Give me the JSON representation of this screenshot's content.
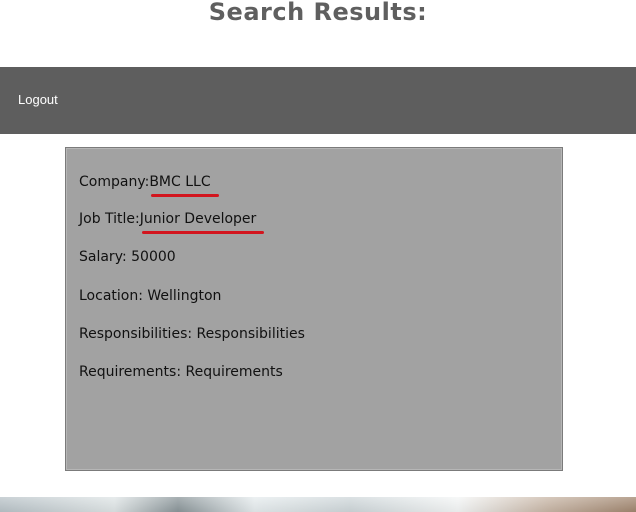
{
  "page": {
    "title": "Search Results:"
  },
  "navbar": {
    "logout_label": "Logout",
    "background": "#5e5e5e"
  },
  "result": {
    "company": {
      "label": "Company:",
      "value": "BMC LLC"
    },
    "job_title": {
      "label": "Job Title:",
      "value": "Junior Developer"
    },
    "salary": {
      "label": "Salary: ",
      "value": "50000"
    },
    "location": {
      "label": "Location: ",
      "value": "Wellington"
    },
    "responsibilities": {
      "label": "Responsibilities: ",
      "value": "Responsibilities"
    },
    "requirements": {
      "label": "Requirements: ",
      "value": "Requirements"
    },
    "card_background": "#a2a2a2",
    "underline_color": "#d2151e"
  }
}
